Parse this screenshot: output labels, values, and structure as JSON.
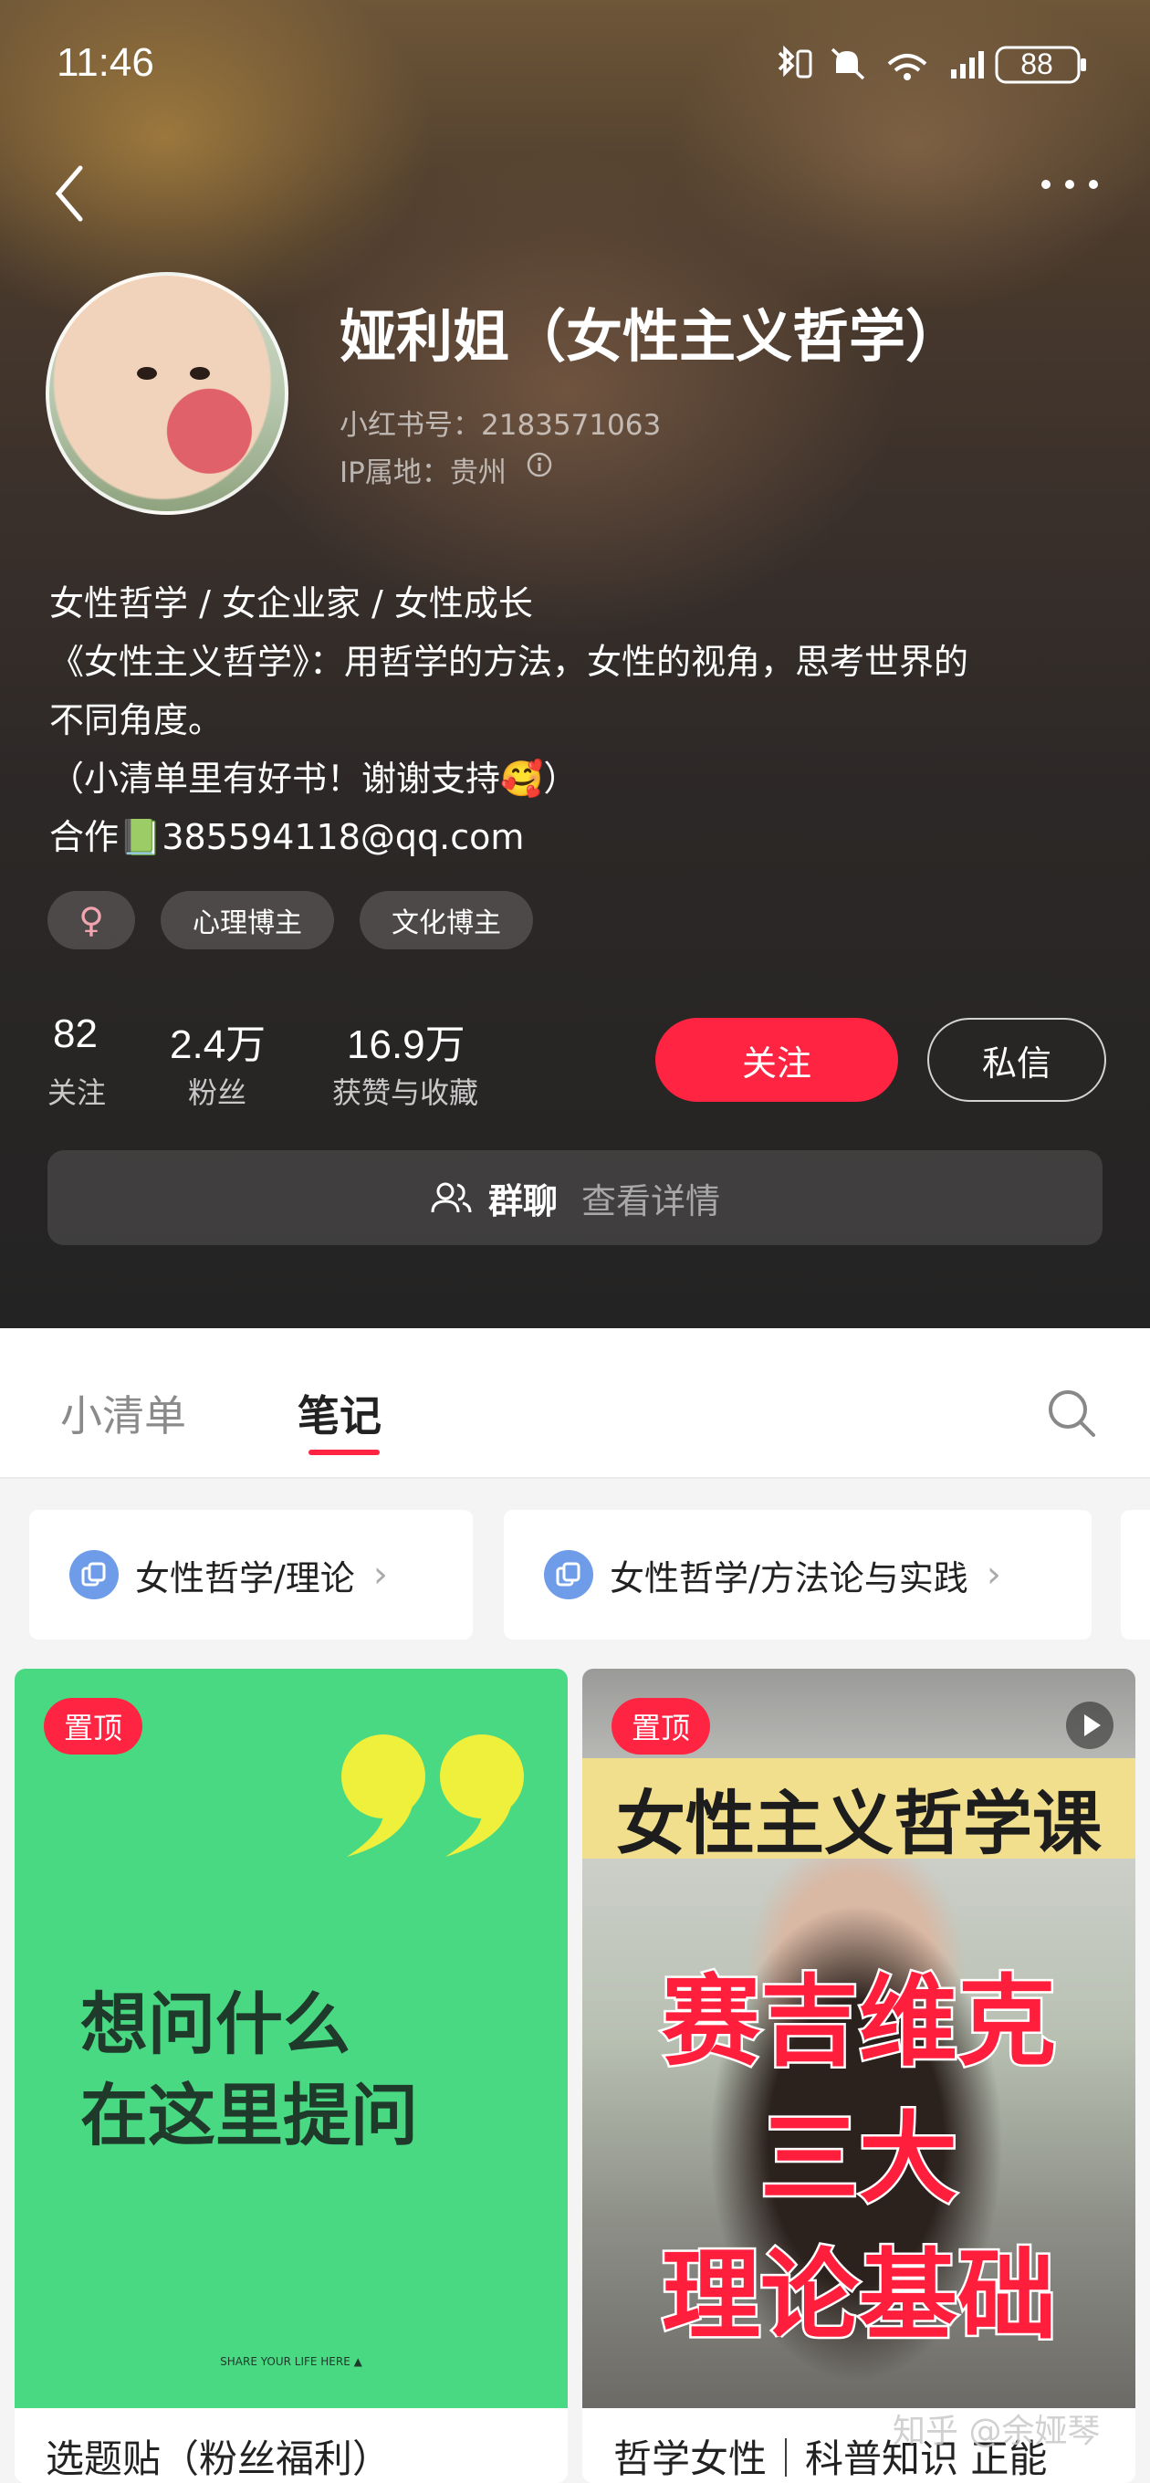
{
  "status_bar": {
    "time": "11:46",
    "battery": "88"
  },
  "profile": {
    "name": "娅利姐（女性主义哲学）",
    "red_id": "小红书号：2183571063",
    "ip_location": "IP属地：贵州",
    "bio_lines": [
      "女性哲学 / 女企业家 / 女性成长",
      "《女性主义哲学》：用哲学的方法，女性的视角，思考世界的",
      "不同角度。",
      "（小清单里有好书！谢谢支持🥰）",
      "合作📗385594118@qq.com"
    ],
    "gender_symbol": "♀",
    "tags": [
      "心理博主",
      "文化博主"
    ]
  },
  "stats": [
    {
      "value": "82",
      "label": "关注"
    },
    {
      "value": "2.4万",
      "label": "粉丝"
    },
    {
      "value": "16.9万",
      "label": "获赞与收藏"
    }
  ],
  "actions": {
    "follow": "关注",
    "message": "私信"
  },
  "group_chat": {
    "label": "群聊",
    "detail": "查看详情"
  },
  "tabs": [
    {
      "label": "小清单",
      "active": false
    },
    {
      "label": "笔记",
      "active": true
    }
  ],
  "collections": [
    {
      "label": "女性哲学/理论"
    },
    {
      "label": "女性哲学/方法论与实践"
    }
  ],
  "notes": [
    {
      "pin_label": "置顶",
      "cover_text": [
        "想问什么",
        "在这里提问"
      ],
      "cover_small": "SHARE YOUR LIFE HERE ▲",
      "title": "选题贴（粉丝福利）"
    },
    {
      "pin_label": "置顶",
      "cover_header": "女性主义哲学课",
      "cover_text": [
        "赛吉维克",
        "三大",
        "理论基础"
      ],
      "title": "哲学女性｜科普知识 正能"
    }
  ],
  "watermark": "知乎 @余娅琴",
  "colors": {
    "accent": "#ff2442",
    "cover_green": "#49d983",
    "quote_yellow": "#eef03b",
    "collection_icon": "#6f9ce8"
  }
}
